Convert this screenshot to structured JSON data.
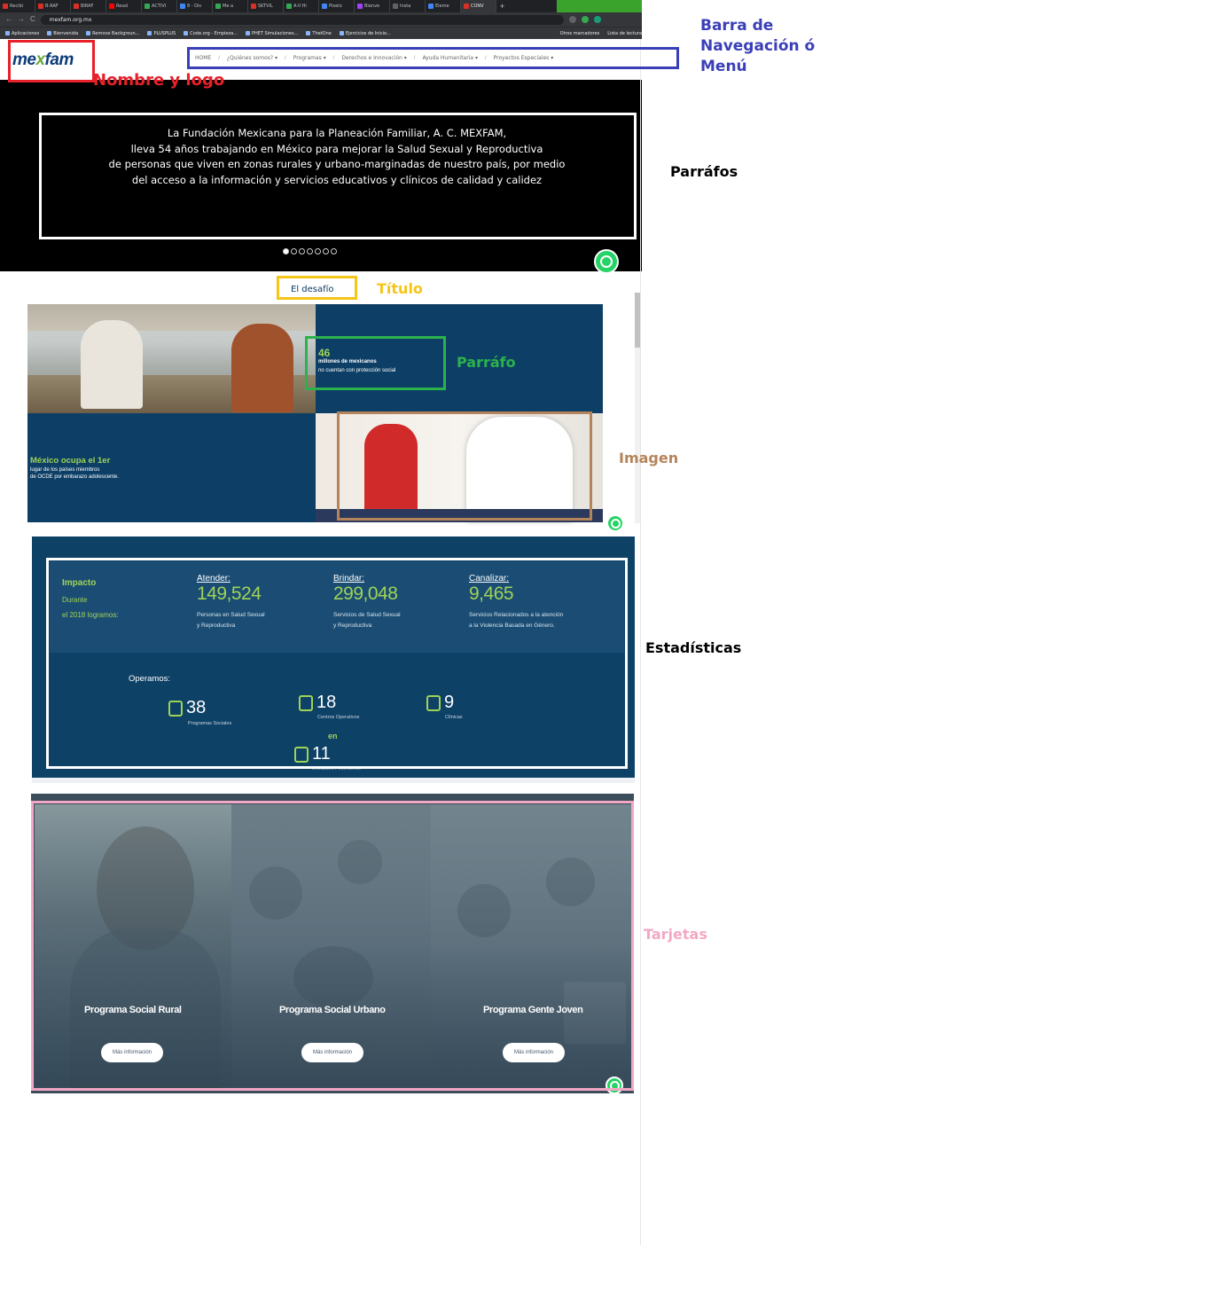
{
  "browser": {
    "tabs": [
      {
        "label": "Recibi",
        "color": "#d93025"
      },
      {
        "label": "B-RAF",
        "color": "#d93025"
      },
      {
        "label": "BIRAF",
        "color": "#d93025"
      },
      {
        "label": "Resol",
        "color": "#ff0000"
      },
      {
        "label": "ACTIVI",
        "color": "#34a853"
      },
      {
        "label": "8 - Dis",
        "color": "#4285f4"
      },
      {
        "label": "Me a",
        "color": "#34a853"
      },
      {
        "label": "SKTVIL",
        "color": "#d93025"
      },
      {
        "label": "A-II Hi",
        "color": "#34a853"
      },
      {
        "label": "Pixelo",
        "color": "#4285f4"
      },
      {
        "label": "Bienve",
        "color": "#a142f4"
      },
      {
        "label": "Insta",
        "color": "#5f6368"
      },
      {
        "label": "Eleme",
        "color": "#4285f4"
      },
      {
        "label": "CONV",
        "color": "#d93025"
      }
    ],
    "new_tab_glyph": "+",
    "url": "mexfam.org.mx",
    "nav_glyphs": [
      "←",
      "→",
      "C"
    ],
    "bookmarks": [
      "Aplicaciones",
      "Bienvenida",
      "Remove Backgroun...",
      "PLUSPLUS",
      "Code.org - Empieza...",
      "PHET Simulaciones...",
      "ThetOne",
      "Ejercicios de Inicio..."
    ],
    "bookmarks_right": [
      "Otros marcadores",
      "Lista de lectura"
    ]
  },
  "site": {
    "logo": {
      "pre": "me",
      "x": "x",
      "post": "fam"
    },
    "nav": [
      "HOME",
      "¿Quiénes somos? ▾",
      "Programas ▾",
      "Derechos e Innovación ▾",
      "Ayuda Humanitaria ▾",
      "Proyectos Especiales ▾"
    ],
    "hero": {
      "lines": [
        "La Fundación Mexicana para la Planeación Familiar, A. C. MEXFAM,",
        "lleva 54 años trabajando en México para mejorar la Salud Sexual y Reproductiva",
        "de personas que viven en zonas rurales y urbano-marginadas de nuestro país, por medio",
        "del acceso a la información y servicios educativos y clínicos de calidad y calidez"
      ],
      "slides": 7,
      "active_slide": 1
    },
    "desafio": {
      "title": "El desafío",
      "stat_46": {
        "number": "46",
        "line1": "millones de mexicanos",
        "line2": "no cuentan con protección social"
      },
      "stat_mx": {
        "headline": "México ocupa el 1er",
        "line1": "lugar de los países miembros",
        "line2": "de OCDE por embarazo adolescente."
      }
    },
    "impacto": {
      "title": "Impacto",
      "sub1": "Durante",
      "sub2": "el 2018 logramos:",
      "columns": [
        {
          "verb": "Atender:",
          "number": "149,524",
          "desc1": "Personas en Salud Sexual",
          "desc2": "y Reproductiva"
        },
        {
          "verb": "Brindar:",
          "number": "299,048",
          "desc1": "Servicios de Salud Sexual",
          "desc2": "y Reproductiva"
        },
        {
          "verb": "Canalizar:",
          "number": "9,465",
          "desc1": "Servicios Relacionados a la atención",
          "desc2": "a la Violencia Basada en Género."
        }
      ],
      "operamos_label": "Operamos:",
      "operamos": [
        {
          "number": "38",
          "label": "Programas Sociales",
          "icon": "people-icon"
        },
        {
          "number": "18",
          "label": "Centros Operativos",
          "icon": "building-icon"
        },
        {
          "number": "9",
          "label": "Clínicas",
          "icon": "clinic-icon"
        }
      ],
      "en_label": "en",
      "entidades": {
        "number": "11",
        "label": "Entidades Federativas",
        "icon": "map-pin-icon"
      }
    },
    "cards": [
      {
        "title": "Programa Social Rural",
        "button": "Más información"
      },
      {
        "title": "Programa Social Urbano",
        "button": "Más información"
      },
      {
        "title": "Programa Gente Joven",
        "button": "Más información"
      }
    ]
  },
  "annotations": {
    "nombre_logo": {
      "label": "Nombre y logo",
      "color": "#e8202a"
    },
    "menu": {
      "line1": "Barra de",
      "line2": "Navegación ó",
      "line3": "Menú",
      "color": "#3a3fb8"
    },
    "parrafos": {
      "label": "Parráfos",
      "color": "#000000"
    },
    "titulo": {
      "label": "Título",
      "color": "#f5c518"
    },
    "parrafo": {
      "label": "Parráfo",
      "color": "#2bb24c"
    },
    "imagen": {
      "label": "Imagen",
      "color": "#b5845a"
    },
    "estadisticas": {
      "label": "Estadísticas",
      "color": "#000000"
    },
    "tarjetas": {
      "label": "Tarjetas",
      "color": "#f4a7c4"
    }
  }
}
